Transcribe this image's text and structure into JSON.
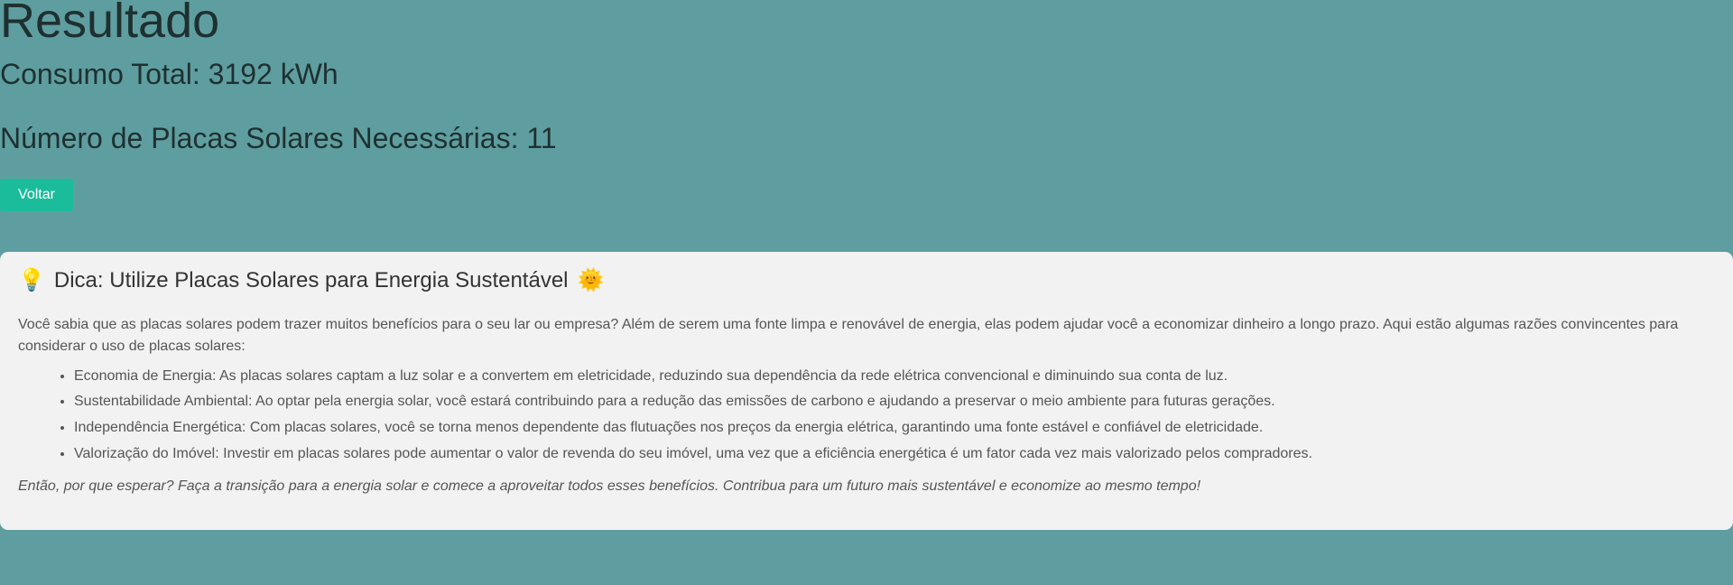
{
  "result": {
    "title": "Resultado",
    "consumo": "Consumo Total: 3192 kWh",
    "placas": "Número de Placas Solares Necessárias: 11",
    "back_label": "Voltar"
  },
  "tip": {
    "icon_left": "lightbulb-icon",
    "icon_right": "sun-face-icon",
    "lightbulb": "💡",
    "title": "Dica: Utilize Placas Solares para Energia Sustentável",
    "sun": "🌞",
    "intro": "Você sabia que as placas solares podem trazer muitos benefícios para o seu lar ou empresa? Além de serem uma fonte limpa e renovável de energia, elas podem ajudar você a economizar dinheiro a longo prazo. Aqui estão algumas razões convincentes para considerar o uso de placas solares:",
    "items": [
      "Economia de Energia: As placas solares captam a luz solar e a convertem em eletricidade, reduzindo sua dependência da rede elétrica convencional e diminuindo sua conta de luz.",
      "Sustentabilidade Ambiental: Ao optar pela energia solar, você estará contribuindo para a redução das emissões de carbono e ajudando a preservar o meio ambiente para futuras gerações.",
      "Independência Energética: Com placas solares, você se torna menos dependente das flutuações nos preços da energia elétrica, garantindo uma fonte estável e confiável de eletricidade.",
      "Valorização do Imóvel: Investir em placas solares pode aumentar o valor de revenda do seu imóvel, uma vez que a eficiência energética é um fator cada vez mais valorizado pelos compradores."
    ],
    "closing": "Então, por que esperar? Faça a transição para a energia solar e comece a aproveitar todos esses benefícios. Contribua para um futuro mais sustentável e economize ao mesmo tempo!"
  },
  "colors": {
    "background": "#5f9ea0",
    "button": "#1abc9c",
    "card": "#f2f2f2"
  }
}
